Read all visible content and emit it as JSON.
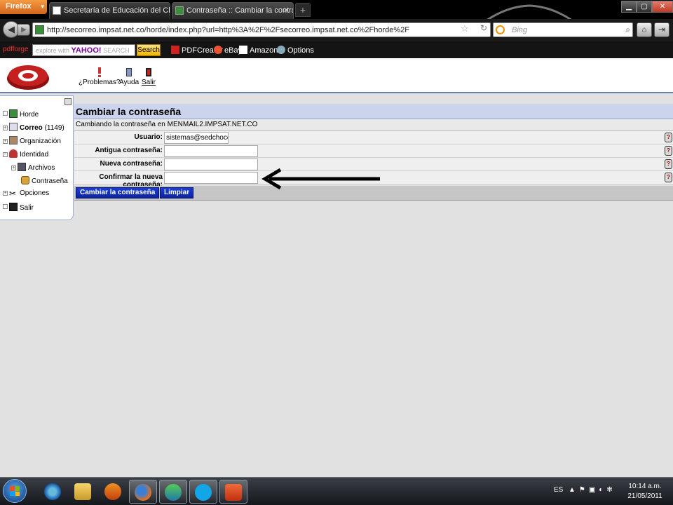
{
  "browser": {
    "menu_button": "Firefox",
    "tabs": [
      {
        "title": "Secretaría de Educación del Chocó"
      },
      {
        "title": "Contraseña :: Cambiar la contraseña"
      }
    ],
    "url": "http://secorreo.impsat.net.co/horde/index.php?url=http%3A%2F%2Fsecorreo.impsat.net.co%2Fhorde%2F",
    "search_placeholder": "Bing",
    "window_controls": [
      "minimize",
      "maximize",
      "close"
    ]
  },
  "toolbar2": {
    "pdfforge": "pdfforge",
    "yahoo_placeholder": "SEARCH",
    "yahoo_brand": "YAHOO!",
    "yahoo_prefix": "explore with",
    "search_button": "Search",
    "items": [
      "PDFCreator",
      "eBay",
      "Amazon",
      "Options"
    ]
  },
  "horde_header": {
    "links": [
      {
        "label": "¿Problemas?",
        "icon": "exclamation-icon"
      },
      {
        "label": "Ayuda",
        "icon": "help-book-icon"
      },
      {
        "label": "Salir",
        "icon": "exit-door-icon"
      }
    ]
  },
  "sidebar": {
    "items": [
      {
        "label": "Horde",
        "bold": false
      },
      {
        "label": "Correo",
        "count": "(1149)",
        "bold": true
      },
      {
        "label": "Organización",
        "bold": false
      },
      {
        "label": "Identidad",
        "bold": false
      },
      {
        "label": "Archivos",
        "bold": false
      },
      {
        "label": "Contraseña",
        "bold": false
      },
      {
        "label": "Opciones",
        "bold": false
      },
      {
        "label": "Salir",
        "bold": false
      }
    ]
  },
  "main": {
    "title": "Cambiar la contraseña",
    "info": "Cambiando la contraseña en MENMAIL2.IMPSAT.NET.CO",
    "form": {
      "username_label": "Usuario:",
      "username_value": "sistemas@sedchoco.g",
      "old_password_label": "Antigua contraseña:",
      "new_password_label": "Nueva contraseña:",
      "confirm_password_label": "Confirmar la nueva contraseña:"
    },
    "buttons": {
      "submit": "Cambiar la contraseña",
      "reset": "Limpiar"
    }
  },
  "taskbar": {
    "apps": [
      "start",
      "internet-explorer",
      "windows-explorer",
      "media-player",
      "firefox",
      "messenger",
      "skype",
      "powerpoint"
    ],
    "language": "ES",
    "time": "10:14 a.m.",
    "date": "21/05/2011"
  }
}
